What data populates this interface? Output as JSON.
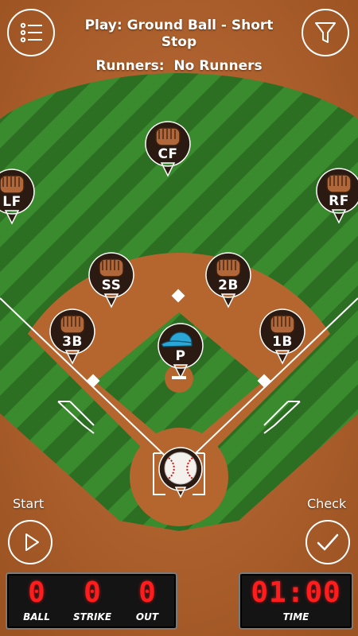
{
  "header": {
    "play_title": "Play: Ground Ball - Short Stop",
    "runners": "Runners:  No Runners"
  },
  "buttons": {
    "menu": {
      "icon": "menu-list-icon"
    },
    "filter": {
      "icon": "filter-funnel-icon"
    },
    "start": {
      "label": "Start",
      "icon": "play-icon"
    },
    "check": {
      "label": "Check",
      "icon": "checkmark-icon"
    }
  },
  "positions": {
    "cf": {
      "label": "CF",
      "icon": "glove-icon"
    },
    "lf": {
      "label": "LF",
      "icon": "glove-icon"
    },
    "rf": {
      "label": "RF",
      "icon": "glove-icon"
    },
    "ss": {
      "label": "SS",
      "icon": "glove-icon"
    },
    "second_base": {
      "label": "2B",
      "icon": "glove-icon"
    },
    "third_base": {
      "label": "3B",
      "icon": "glove-icon"
    },
    "first_base": {
      "label": "1B",
      "icon": "glove-icon"
    },
    "pitcher": {
      "label": "P",
      "icon": "cap-icon"
    }
  },
  "ball": {
    "icon": "baseball-icon"
  },
  "scoreboard": {
    "ball": {
      "value": "0",
      "label": "BALL"
    },
    "strike": {
      "value": "0",
      "label": "STRIKE"
    },
    "out": {
      "value": "0",
      "label": "OUT"
    },
    "time": {
      "value": "01:00",
      "label": "TIME"
    }
  },
  "colors": {
    "dirt": "#b2632f",
    "grass_light": "#3c8a2f",
    "grass_dark": "#2b6d21",
    "pin_fill": "#2a1a12",
    "led_red": "#ff1c1c",
    "cap_blue": "#2aa7d6"
  }
}
